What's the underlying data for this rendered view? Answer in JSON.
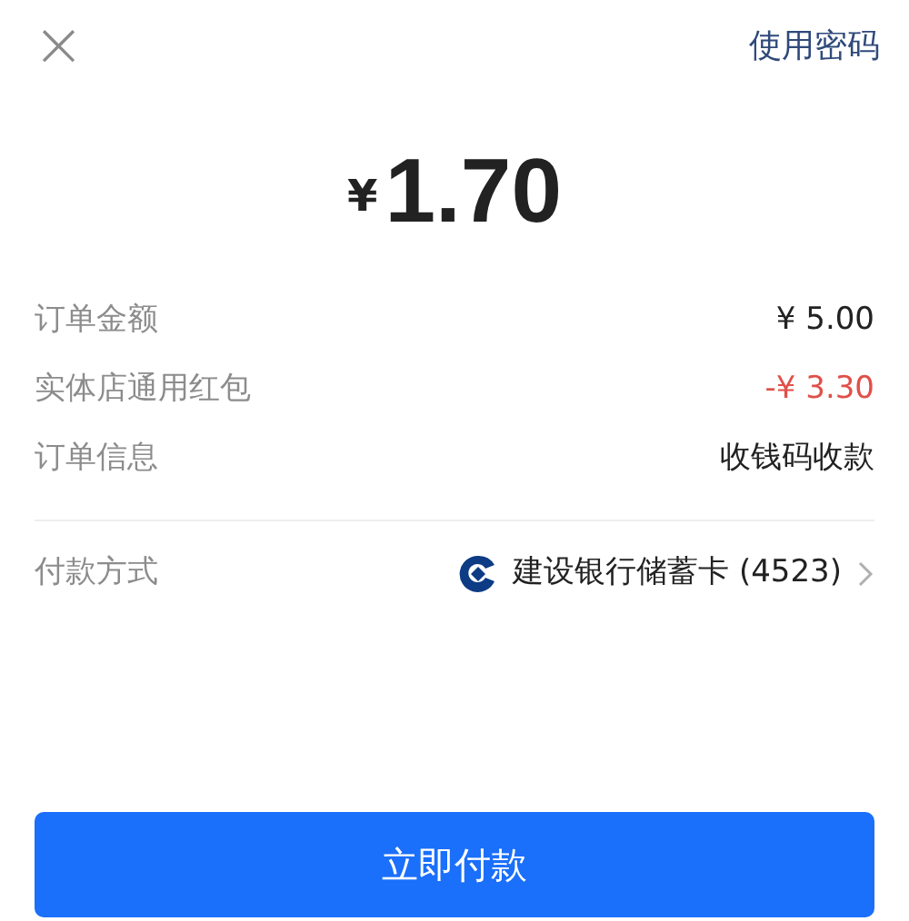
{
  "header": {
    "close": "×",
    "action": "使用密码"
  },
  "amount": {
    "currency": "¥",
    "value": "1.70"
  },
  "details": [
    {
      "label": "订单金额",
      "value": "¥ 5.00",
      "kind": "plain"
    },
    {
      "label": "实体店通用红包",
      "value": "-¥ 3.30",
      "kind": "deduction"
    },
    {
      "label": "订单信息",
      "value": "收钱码收款",
      "kind": "plain"
    }
  ],
  "payment_method": {
    "label": "付款方式",
    "value": "建设银行储蓄卡 (4523)"
  },
  "pay_button": "立即付款"
}
